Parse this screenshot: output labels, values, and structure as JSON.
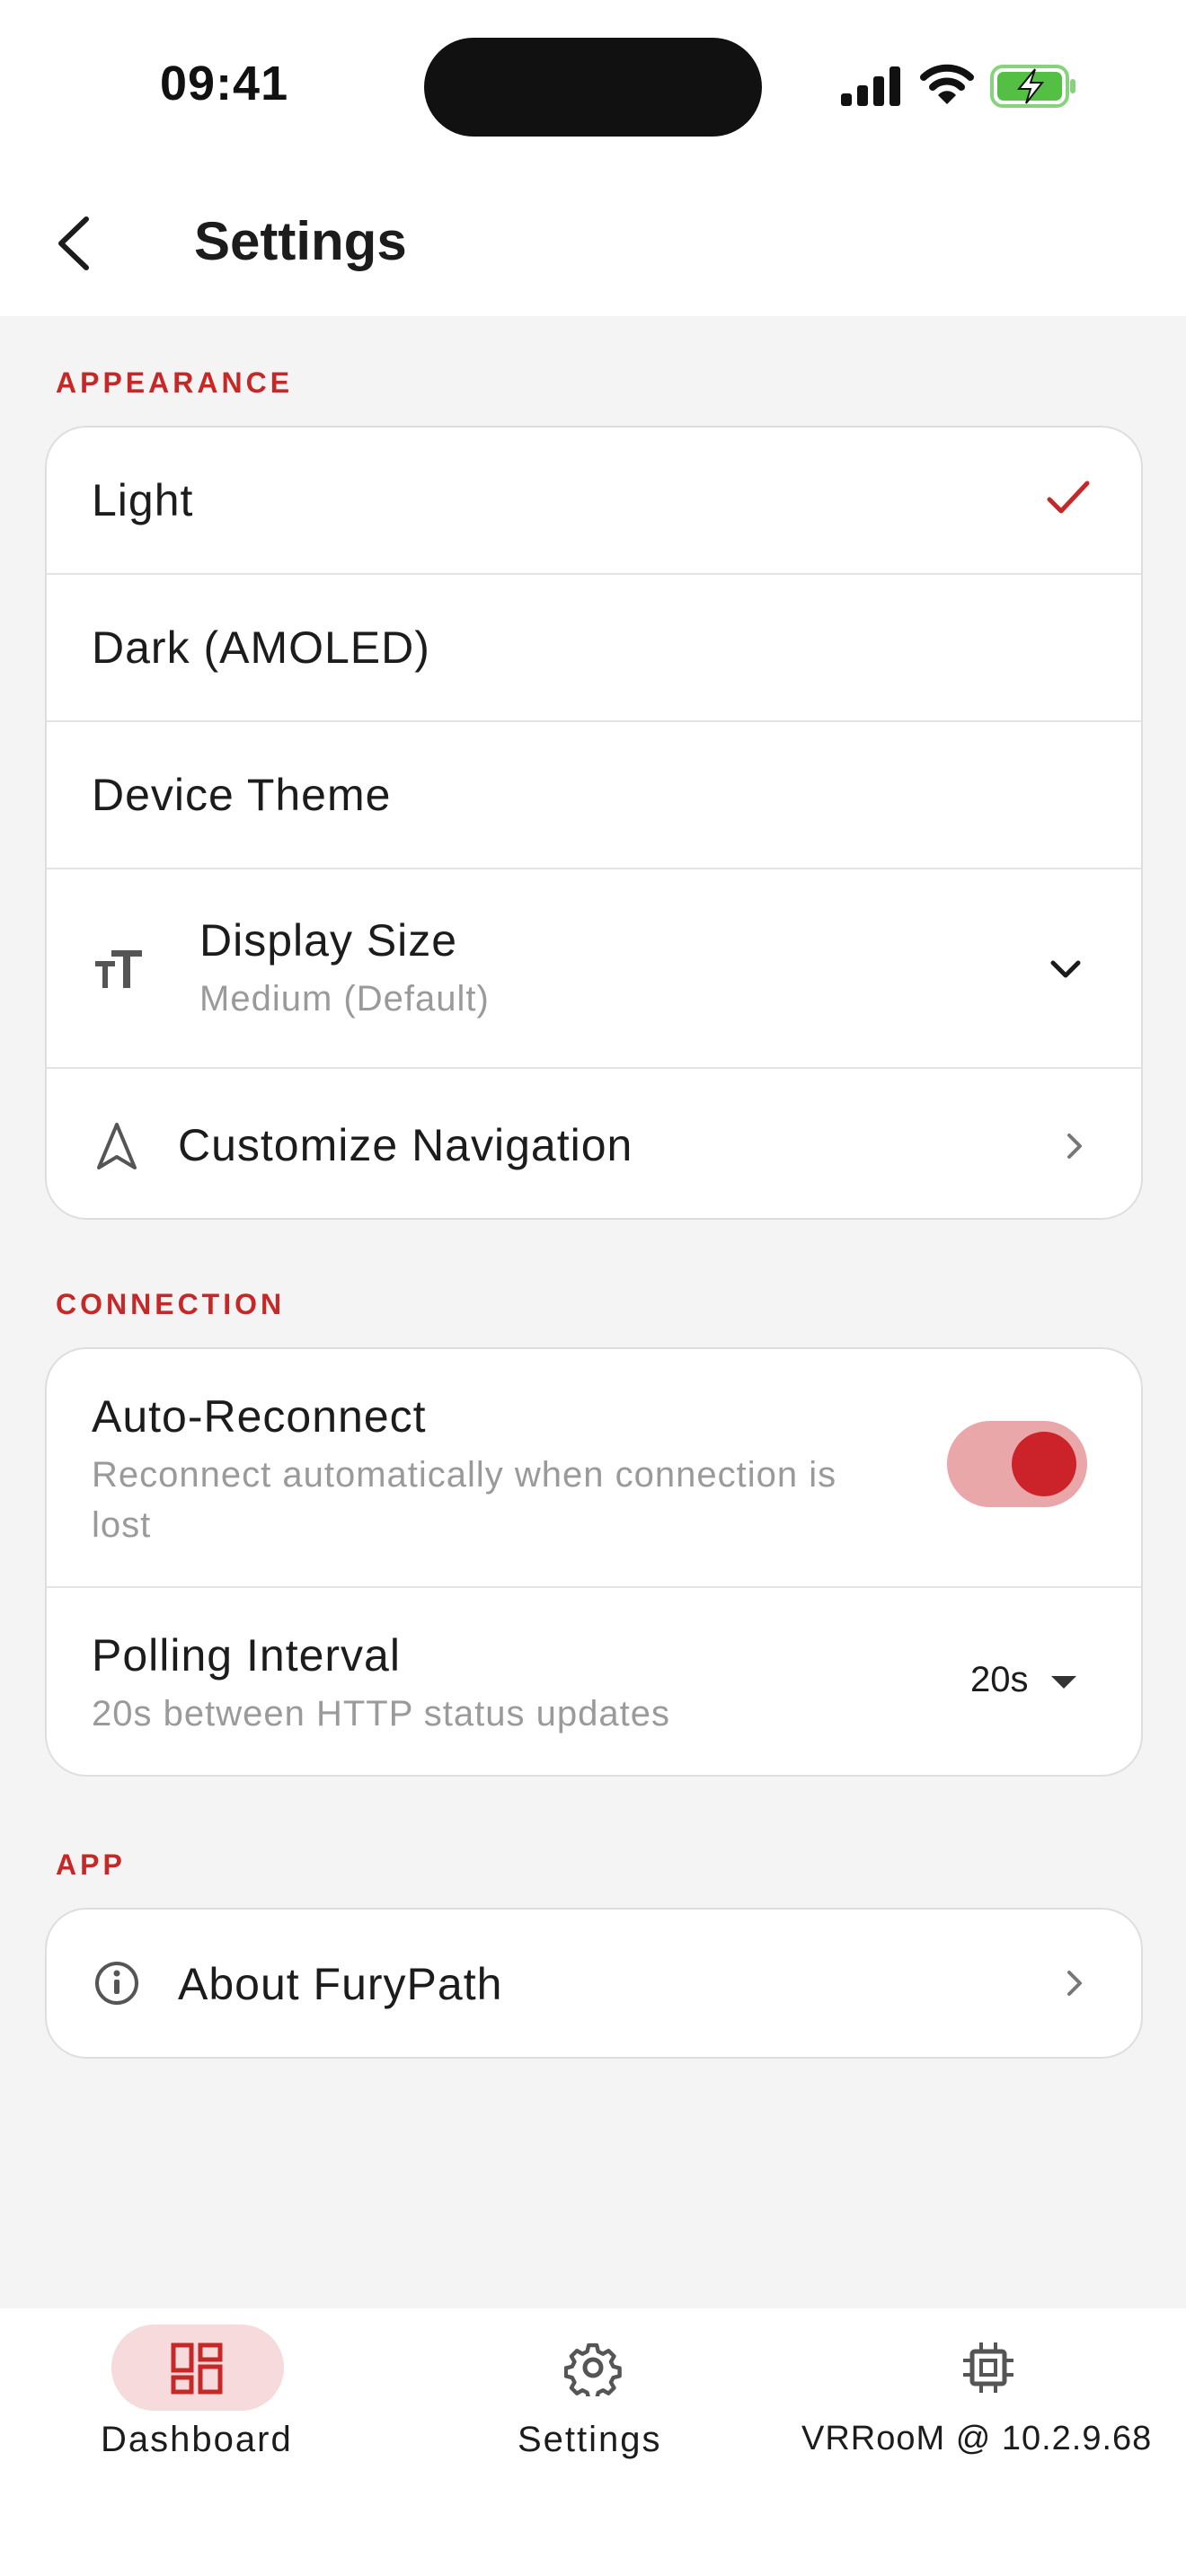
{
  "status_bar": {
    "time": "09:41"
  },
  "header": {
    "title": "Settings"
  },
  "sections": {
    "appearance": {
      "label": "APPEARANCE",
      "theme_options": [
        "Light",
        "Dark (AMOLED)",
        "Device Theme"
      ],
      "selected_theme": "Light",
      "display_size": {
        "title": "Display Size",
        "value": "Medium (Default)"
      },
      "customize_navigation": {
        "title": "Customize Navigation"
      }
    },
    "connection": {
      "label": "CONNECTION",
      "auto_reconnect": {
        "title": "Auto-Reconnect",
        "subtitle_line1": "Reconnect automatically when connection is",
        "subtitle_line2": "lost",
        "enabled": true
      },
      "polling_interval": {
        "title": "Polling Interval",
        "subtitle": "20s between HTTP status updates",
        "value": "20s"
      }
    },
    "app": {
      "label": "APP",
      "about": {
        "title": "About FuryPath"
      }
    }
  },
  "bottom_nav": {
    "items": [
      {
        "label": "Dashboard",
        "icon": "dashboard-icon",
        "active": true
      },
      {
        "label": "Settings",
        "icon": "gear-icon",
        "active": false
      },
      {
        "label": "VRRooM @ 10.2.9.68",
        "icon": "chip-icon",
        "active": false
      }
    ]
  },
  "colors": {
    "accent": "#c62828",
    "toggle_track": "#eaa7aa",
    "toggle_knob": "#cc2229",
    "active_nav_pill": "#f7dadb",
    "background": "#f4f4f4"
  }
}
